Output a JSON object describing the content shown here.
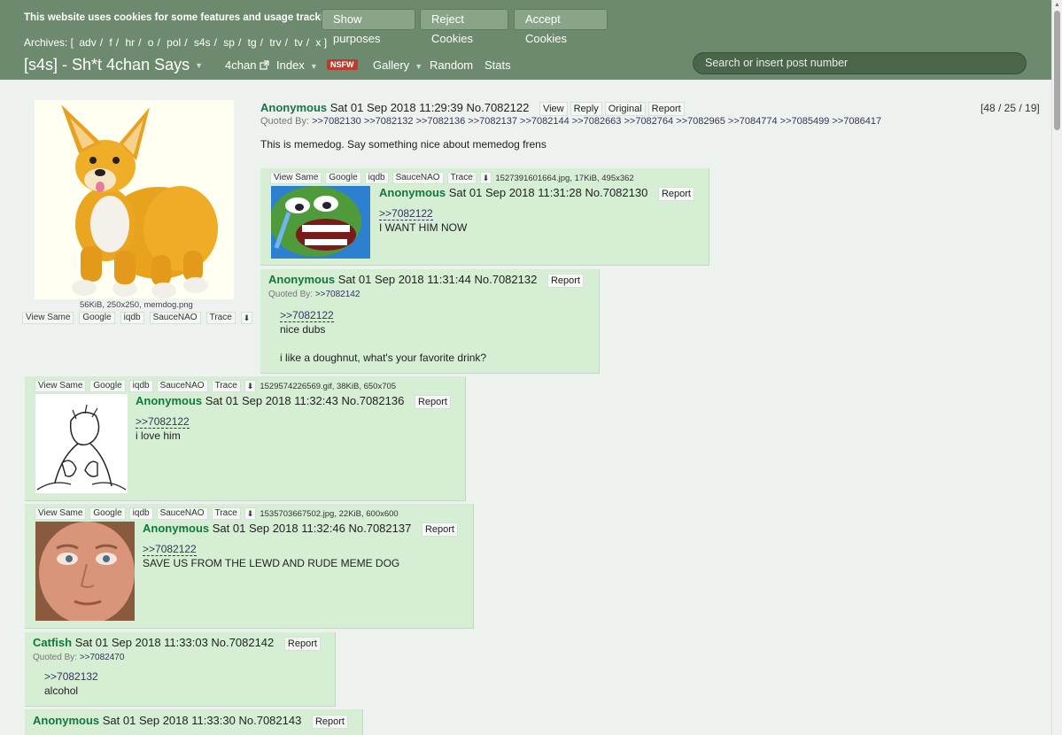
{
  "cookie_bar": {
    "text": "This website uses cookies for some features and usage tracking.",
    "show_purposes": "Show purposes",
    "reject": "Reject Cookies",
    "accept": "Accept Cookies"
  },
  "archives": {
    "prefix": "Archives: [",
    "suffix": "]",
    "boards": [
      "adv",
      "f",
      "hr",
      "o",
      "pol",
      "s4s",
      "sp",
      "tg",
      "trv",
      "tv",
      "x"
    ]
  },
  "nav": {
    "board_title": "[s4s] - Sh*t 4chan Says",
    "fourchan": "4chan",
    "index": "Index",
    "nsfw": "NSFW",
    "gallery": "Gallery",
    "random": "Random",
    "stats": "Stats",
    "search_placeholder": "Search or insert post number"
  },
  "op": {
    "file_info": "56KiB, 250x250, memdog.png",
    "tools": [
      "View Same",
      "Google",
      "iqdb",
      "SauceNAO",
      "Trace"
    ],
    "name": "Anonymous",
    "date": "Sat 01 Sep 2018 11:29:39",
    "post_no": "No.7082122",
    "actions": [
      "View",
      "Reply",
      "Original",
      "Report"
    ],
    "counts": "[48 / 25 / 19]",
    "quoted_by_label": "Quoted By:",
    "quoted_by": ">>7082130 >>7082132 >>7082136 >>7082137 >>7082144 >>7082663 >>7082764 >>7082965 >>7084774 >>7085499 >>7086417",
    "body": "This is memedog. Say something nice about memedog frens"
  },
  "tools": [
    "View Same",
    "Google",
    "iqdb",
    "SauceNAO",
    "Trace"
  ],
  "report_label": "Report",
  "quoted_by_label": "Quoted By:",
  "replies": [
    {
      "file_info": "1527391601664.jpg, 17KiB, 495x362",
      "name": "Anonymous",
      "date": "Sat 01 Sep 2018 11:31:28",
      "post_no": "No.7082130",
      "quote": ">>7082122",
      "lines": [
        "I WANT HIM NOW"
      ]
    },
    {
      "name": "Anonymous",
      "date": "Sat 01 Sep 2018 11:31:44",
      "post_no": "No.7082132",
      "quoted_by": ">>7082142",
      "quote": ">>7082122",
      "lines": [
        "nice dubs",
        "i like a doughnut, what's your favorite drink?"
      ]
    },
    {
      "file_info": "1529574226569.gif, 38KiB, 650x705",
      "name": "Anonymous",
      "date": "Sat 01 Sep 2018 11:32:43",
      "post_no": "No.7082136",
      "quote": ">>7082122",
      "lines": [
        "i love him"
      ]
    },
    {
      "file_info": "1535703667502.jpg, 22KiB, 600x600",
      "name": "Anonymous",
      "date": "Sat 01 Sep 2018 11:32:46",
      "post_no": "No.7082137",
      "quote": ">>7082122",
      "lines": [
        "SAVE US FROM THE LEWD AND RUDE MEME DOG"
      ]
    },
    {
      "name": "Catfish",
      "date": "Sat 01 Sep 2018 11:33:03",
      "post_no": "No.7082142",
      "quoted_by": ">>7082470",
      "quote": ">>7082132",
      "lines": [
        "alcohol"
      ]
    },
    {
      "name": "Anonymous",
      "date": "Sat 01 Sep 2018 11:33:30",
      "post_no": "No.7082143"
    }
  ]
}
